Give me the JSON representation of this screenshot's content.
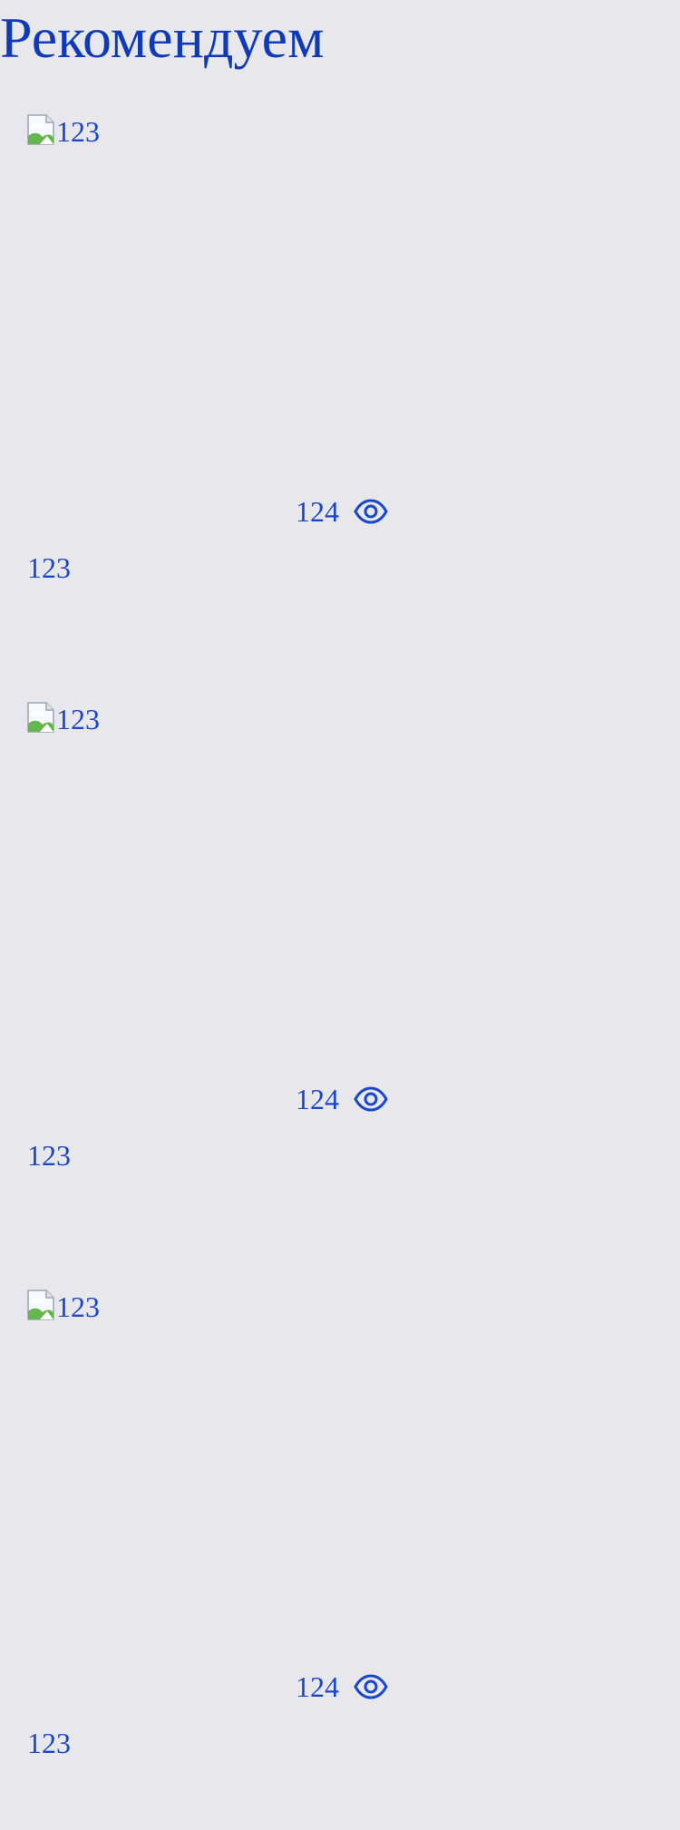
{
  "section": {
    "title": "Рекомендуем"
  },
  "cards": [
    {
      "image_alt": "123",
      "views": "124",
      "caption": "123"
    },
    {
      "image_alt": "123",
      "views": "124",
      "caption": "123"
    },
    {
      "image_alt": "123",
      "views": "124",
      "caption": "123"
    }
  ],
  "icons": {
    "image": "broken-image-icon",
    "views": "eye-icon"
  },
  "colors": {
    "background": "#e8e8ec",
    "text": "#1a47c9",
    "title": "#0f3bb8"
  }
}
